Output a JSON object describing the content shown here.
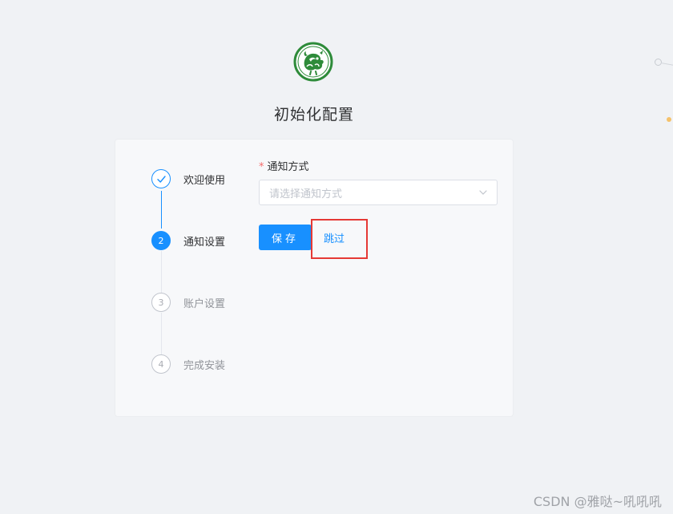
{
  "page": {
    "title": "初始化配置",
    "watermark": "CSDN @雅哒~吼吼吼"
  },
  "steps": [
    {
      "label": "欢迎使用",
      "status": "done",
      "marker": "✓"
    },
    {
      "label": "通知设置",
      "status": "active",
      "marker": "2"
    },
    {
      "label": "账户设置",
      "status": "pending",
      "marker": "3"
    },
    {
      "label": "完成安装",
      "status": "pending",
      "marker": "4"
    }
  ],
  "form": {
    "field_label": "通知方式",
    "required_mark": "*",
    "select_placeholder": "请选择通知方式",
    "save_label": "保存",
    "skip_label": "跳过"
  },
  "icons": {
    "logo": "qilin-logo",
    "step_done": "check-icon",
    "select_caret": "chevron-down-icon"
  },
  "colors": {
    "primary": "#1890ff",
    "required": "#f56c6c",
    "highlight": "#e53935",
    "logo_green": "#2e8b3a",
    "background": "#f0f2f5"
  }
}
